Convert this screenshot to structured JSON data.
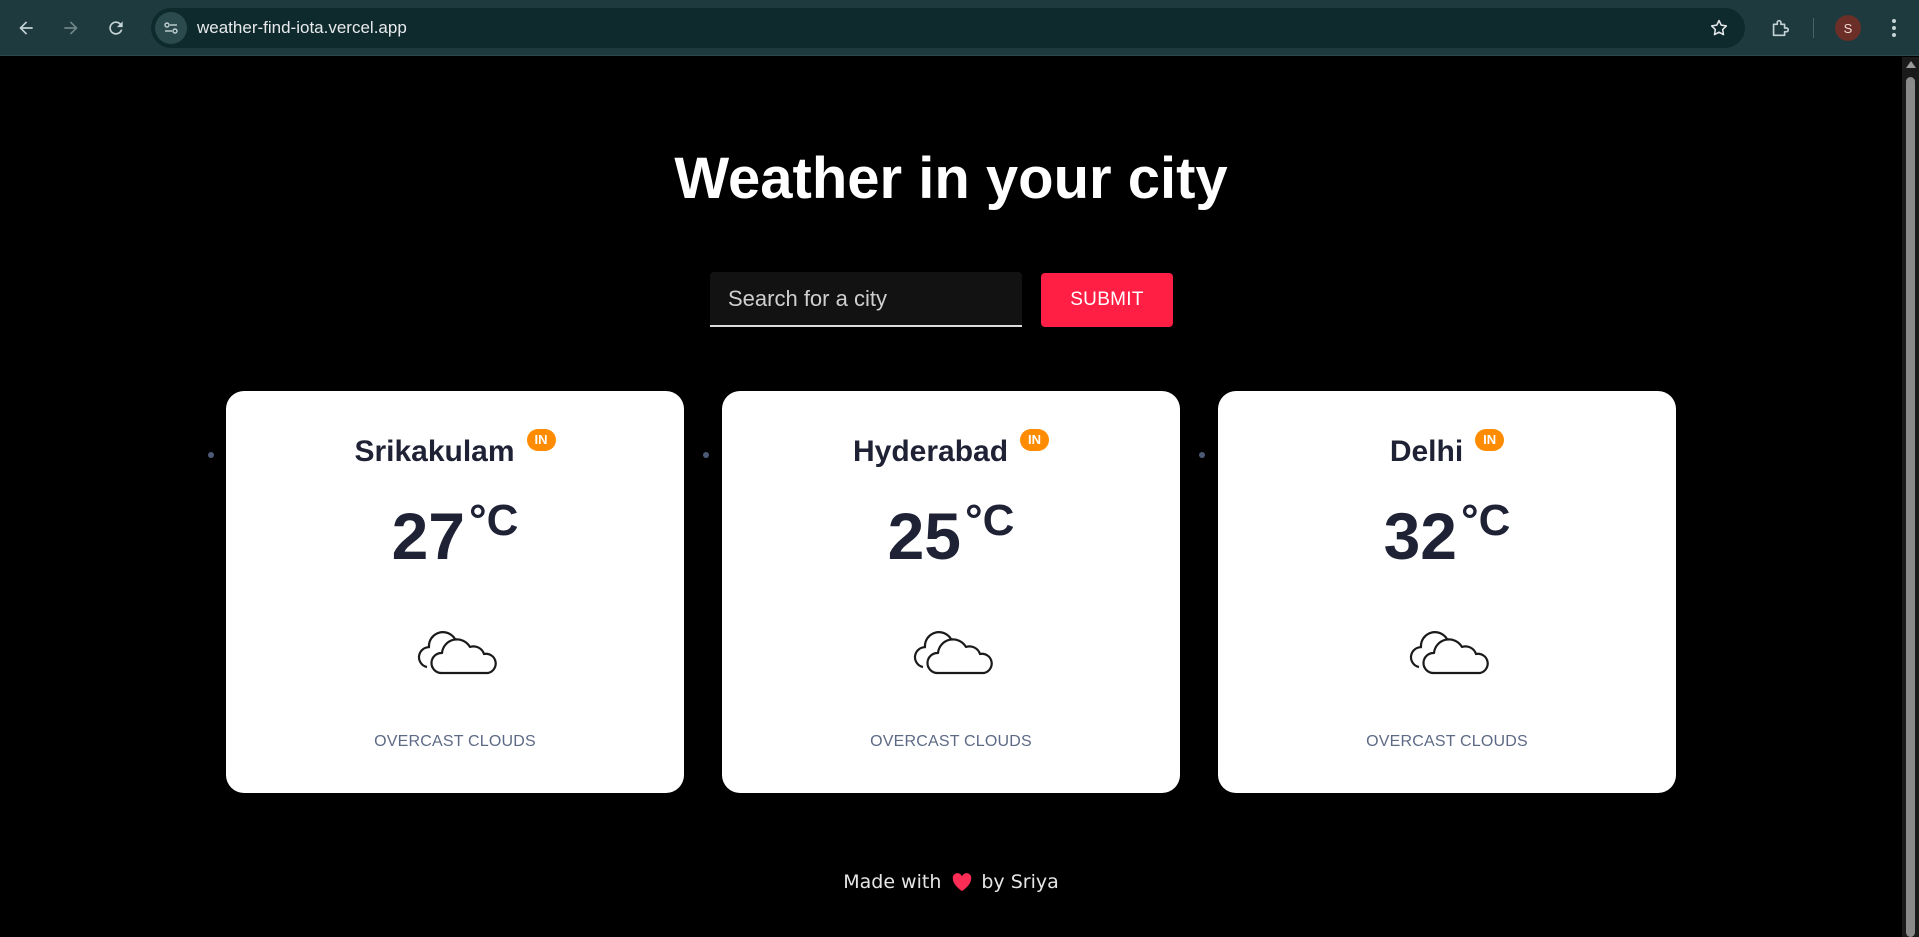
{
  "browser": {
    "url": "weather-find-iota.vercel.app",
    "profile_initial": "S",
    "icons": [
      "back-icon",
      "forward-icon",
      "reload-icon",
      "site-info-icon",
      "star-icon",
      "extensions-icon",
      "more-menu-icon"
    ]
  },
  "page": {
    "title": "Weather in your city",
    "search": {
      "placeholder": "Search for a city",
      "value": ""
    },
    "submit_label": "SUBMIT",
    "cards": [
      {
        "city": "Srikakulam",
        "country": "IN",
        "temp": "27",
        "unit": "°C",
        "description": "OVERCAST CLOUDS",
        "icon": "cloud-icon"
      },
      {
        "city": "Hyderabad",
        "country": "IN",
        "temp": "25",
        "unit": "°C",
        "description": "OVERCAST CLOUDS",
        "icon": "cloud-icon"
      },
      {
        "city": "Delhi",
        "country": "IN",
        "temp": "32",
        "unit": "°C",
        "description": "OVERCAST CLOUDS",
        "icon": "cloud-icon"
      }
    ],
    "footer": {
      "prefix": "Made with",
      "suffix": "by Sriya",
      "icon": "heart-icon"
    }
  },
  "colors": {
    "background": "#000000",
    "submit": "#ff1e44",
    "badge": "#ff8c00",
    "card": "#ffffff",
    "text_dark": "#1f2235",
    "desc": "#5d6a85",
    "heart": "#ff2d55"
  }
}
